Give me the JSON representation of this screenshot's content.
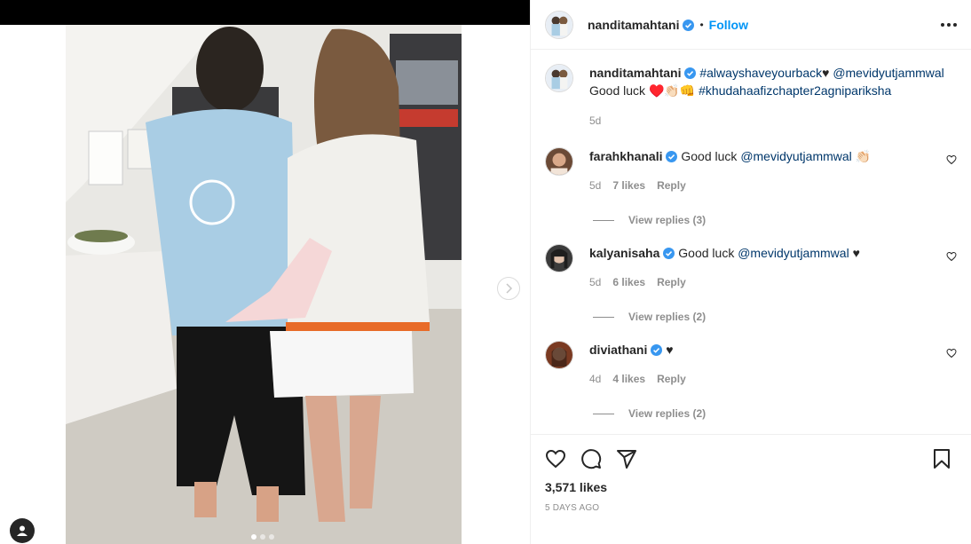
{
  "post": {
    "author": "nanditamahtani",
    "follow_label": "Follow",
    "separator": "•",
    "caption": {
      "hashtag1": "#alwayshaveyourback",
      "heart": "♥",
      "mention": "@mevidyutjammwal",
      "line2_text": "Good luck",
      "line2_emojis": "♥️👏🏻👊",
      "hashtag2": "#khudahaafizchapter2agnipariksha",
      "time": "5d"
    },
    "likes_label": "3,571 likes",
    "date_label": "5 DAYS AGO"
  },
  "comments": [
    {
      "user": "farahkhanali",
      "text": "Good luck",
      "mention": "@mevidyutjammwal",
      "suffix": "👏🏻",
      "time": "5d",
      "likes": "7 likes",
      "reply": "Reply",
      "view_replies": "View replies (3)"
    },
    {
      "user": "kalyanisaha",
      "text": "Good luck",
      "mention": "@mevidyutjammwal",
      "suffix": "♥",
      "time": "5d",
      "likes": "6 likes",
      "reply": "Reply",
      "view_replies": "View replies (2)"
    },
    {
      "user": "diviathani",
      "text": "",
      "mention": "",
      "suffix": "♥",
      "time": "4d",
      "likes": "4 likes",
      "reply": "Reply",
      "view_replies": "View replies (2)"
    }
  ],
  "icons": {
    "like": "heart-icon",
    "comment": "comment-icon",
    "share": "share-icon",
    "save": "bookmark-icon",
    "more": "more-options-icon",
    "next": "chevron-right-icon",
    "verified": "verified-badge-icon",
    "tag": "user-tag-icon"
  },
  "colors": {
    "accent": "#0095f6",
    "link": "#00376b",
    "muted": "#8e8e8e",
    "verified": "#3897f0"
  }
}
